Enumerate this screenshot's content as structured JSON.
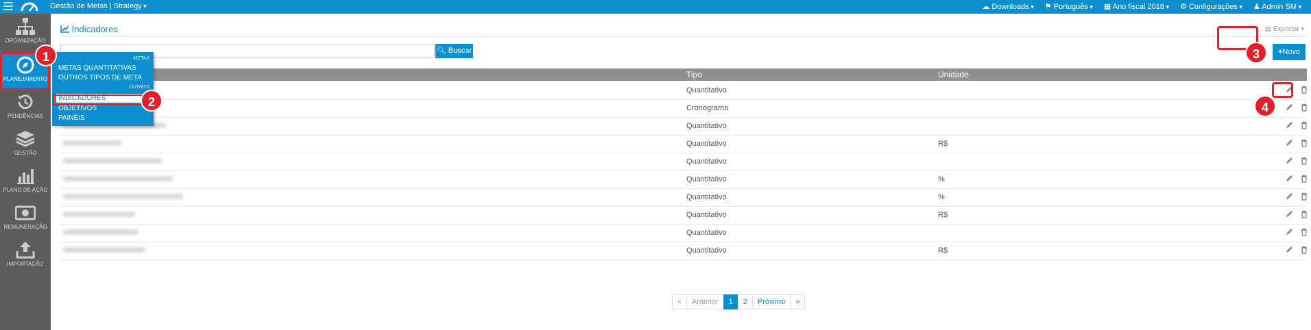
{
  "header": {
    "app_title": "Gestão de Metas | Strategy",
    "menu": {
      "downloads": "Downloads",
      "language": "Português",
      "fiscal_year": "Ano fiscal 2018",
      "settings": "Configurações",
      "user": "Admin SM"
    }
  },
  "sidebar": {
    "items": [
      {
        "label": "ORGANIZAÇÃO",
        "icon": "org-chart-icon"
      },
      {
        "label": "PLANEJAMENTO",
        "icon": "compass-icon"
      },
      {
        "label": "PENDÊNCIAS",
        "icon": "history-icon"
      },
      {
        "label": "GESTÃO",
        "icon": "layers-icon"
      },
      {
        "label": "PLANO DE AÇÃO",
        "icon": "bar-chart-icon"
      },
      {
        "label": "REMUNERAÇÃO",
        "icon": "money-icon"
      },
      {
        "label": "IMPORTAÇÃO",
        "icon": "upload-icon"
      }
    ]
  },
  "dropdown": {
    "section_metas": "METAS",
    "section_outros": "OUTROS",
    "items": [
      "METAS QUANTITATIVAS",
      "OUTROS TIPOS DE META",
      "INDICADORES",
      "OBJETIVOS",
      "PAINÉIS"
    ]
  },
  "page": {
    "title": "Indicadores",
    "export_label": "Exportar",
    "search_button": "Buscar",
    "new_button": "Novo"
  },
  "table": {
    "columns": {
      "tipo": "Tipo",
      "unidade": "Unidade"
    },
    "rows": [
      {
        "tipo": "Quantitativo",
        "unidade": ""
      },
      {
        "tipo": "Cronograma",
        "unidade": ""
      },
      {
        "tipo": "Quantitativo",
        "unidade": ""
      },
      {
        "tipo": "Quantitativo",
        "unidade": "R$"
      },
      {
        "tipo": "Quantitativo",
        "unidade": ""
      },
      {
        "tipo": "Quantitativo",
        "unidade": "%"
      },
      {
        "tipo": "Quantitativo",
        "unidade": "%"
      },
      {
        "tipo": "Quantitativo",
        "unidade": "R$"
      },
      {
        "tipo": "Quantitativo",
        "unidade": ""
      },
      {
        "tipo": "Quantitativo",
        "unidade": "R$"
      }
    ]
  },
  "pagination": {
    "first": "«",
    "prev": "Anterior",
    "page1": "1",
    "page2": "2",
    "next": "Próximo",
    "last": "»"
  },
  "annotations": {
    "b1": "1",
    "b2": "2",
    "b3": "3",
    "b4": "4"
  },
  "colors": {
    "accent": "#0d8fcf",
    "sidebar": "#5c5c5c",
    "highlight": "#e0202a"
  }
}
